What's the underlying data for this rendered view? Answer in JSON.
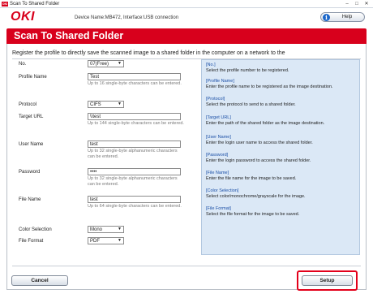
{
  "window": {
    "title": "Scan To Shared Folder",
    "app_icon_text": "OKI",
    "controls": {
      "minimize": "–",
      "maximize": "□",
      "close": "✕"
    }
  },
  "header": {
    "logo": "OKI",
    "device_info": "Device Name:MB472, Interface:USB connection",
    "help_label": "Help",
    "help_icon": "info-icon"
  },
  "banner": {
    "title": "Scan To Shared Folder"
  },
  "intro": "Register the profile to directly save the scanned image to a shared folder in the computer on a network to the",
  "form": {
    "no": {
      "label": "No.",
      "value": "07(Free)"
    },
    "profile_name": {
      "label": "Profile Name",
      "value": "Test",
      "hint": "Up to 16 single-byte characters can be entered."
    },
    "protocol": {
      "label": "Protocol",
      "value": "CIFS"
    },
    "target_url": {
      "label": "Target URL",
      "value": "\\\\test",
      "hint": "Up to 144 single-byte characters can be entered."
    },
    "user_name": {
      "label": "User Name",
      "value": "test",
      "hint": "Up to 32 single-byte alphanumeric characters can be entered."
    },
    "password": {
      "label": "Password",
      "value": "••••",
      "hint": "Up to 32 single-byte alphanumeric characters can be entered."
    },
    "file_name": {
      "label": "File Name",
      "value": "test",
      "hint": "Up to 64 single-byte characters can be entered."
    },
    "color_selection": {
      "label": "Color Selection",
      "value": "Mono"
    },
    "file_format": {
      "label": "File Format",
      "value": "PDF"
    }
  },
  "help_panel": [
    {
      "heading": "[No.]",
      "text": "Select the profile number to be registered."
    },
    {
      "heading": "[Profile Name]",
      "text": "Enter the profile name to be registered as the image destination."
    },
    {
      "heading": "[Protocol]",
      "text": "Select the protocol to send to a shared folder."
    },
    {
      "heading": "[Target URL]",
      "text": "Enter the path of the shared folder as the image destination."
    },
    {
      "heading": "[User Name]",
      "text": "Enter the login user name to access the shared folder."
    },
    {
      "heading": "[Password]",
      "text": "Enter the login password to access the shared folder."
    },
    {
      "heading": "[File Name]",
      "text": "Enter the file name for the image to be saved."
    },
    {
      "heading": "[Color Selection]",
      "text": "Select color/monochrome/grayscale for the image."
    },
    {
      "heading": "[File Format]",
      "text": "Select the file format for the image to be saved."
    }
  ],
  "buttons": {
    "cancel": "Cancel",
    "setup": "Setup"
  },
  "colors": {
    "brand_red": "#d8001c",
    "help_panel_bg": "#dbe8f6",
    "help_heading": "#1b4fa6"
  }
}
